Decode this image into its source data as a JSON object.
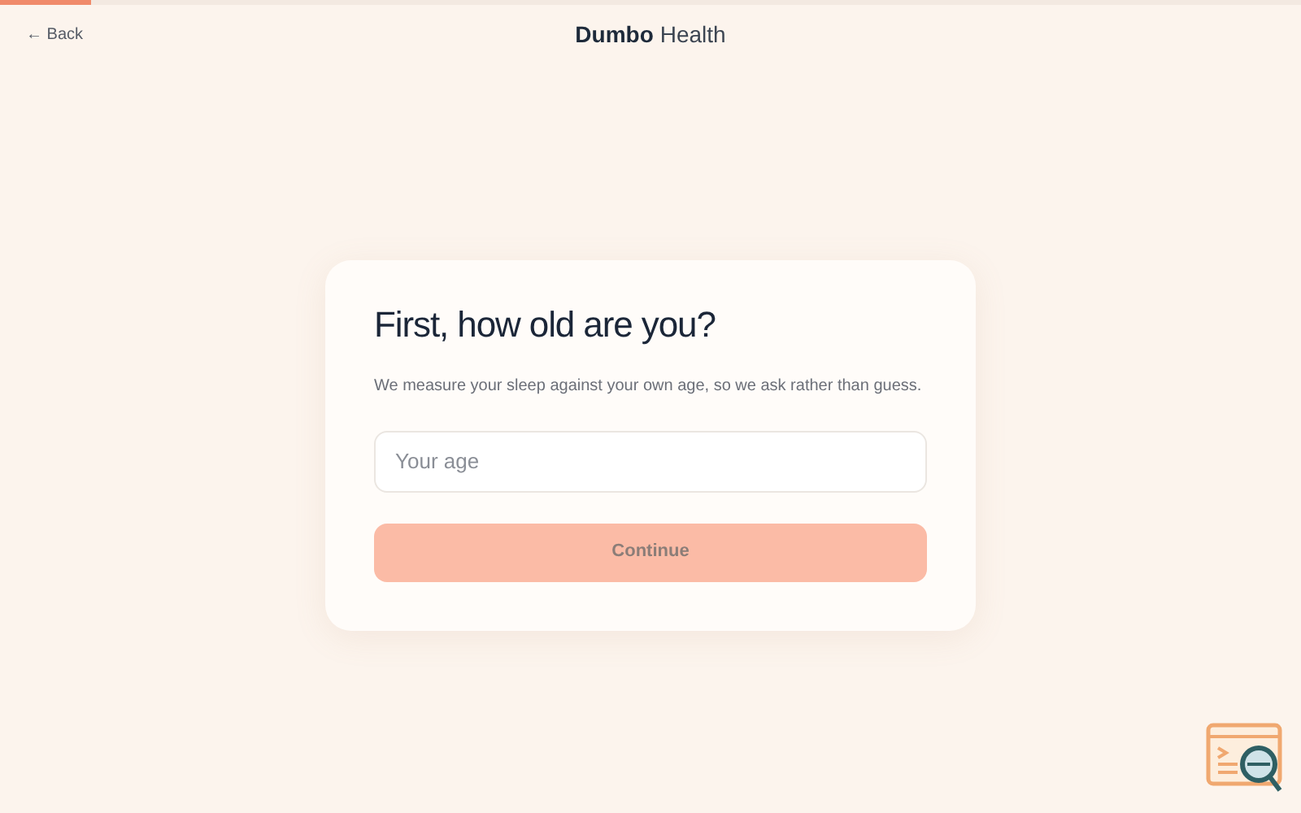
{
  "progress": {
    "level": 0.07
  },
  "header": {
    "back": "← Back",
    "logo": {
      "bold": "Dumbo",
      "light": "Health"
    }
  },
  "card": {
    "title": "First, how old are you?",
    "subtitle": "We measure your sleep against your own age, so we ask rather than guess.",
    "field": {
      "placeholder": "Your age"
    },
    "button": {
      "label": "Continue",
      "disabled": true
    }
  }
}
